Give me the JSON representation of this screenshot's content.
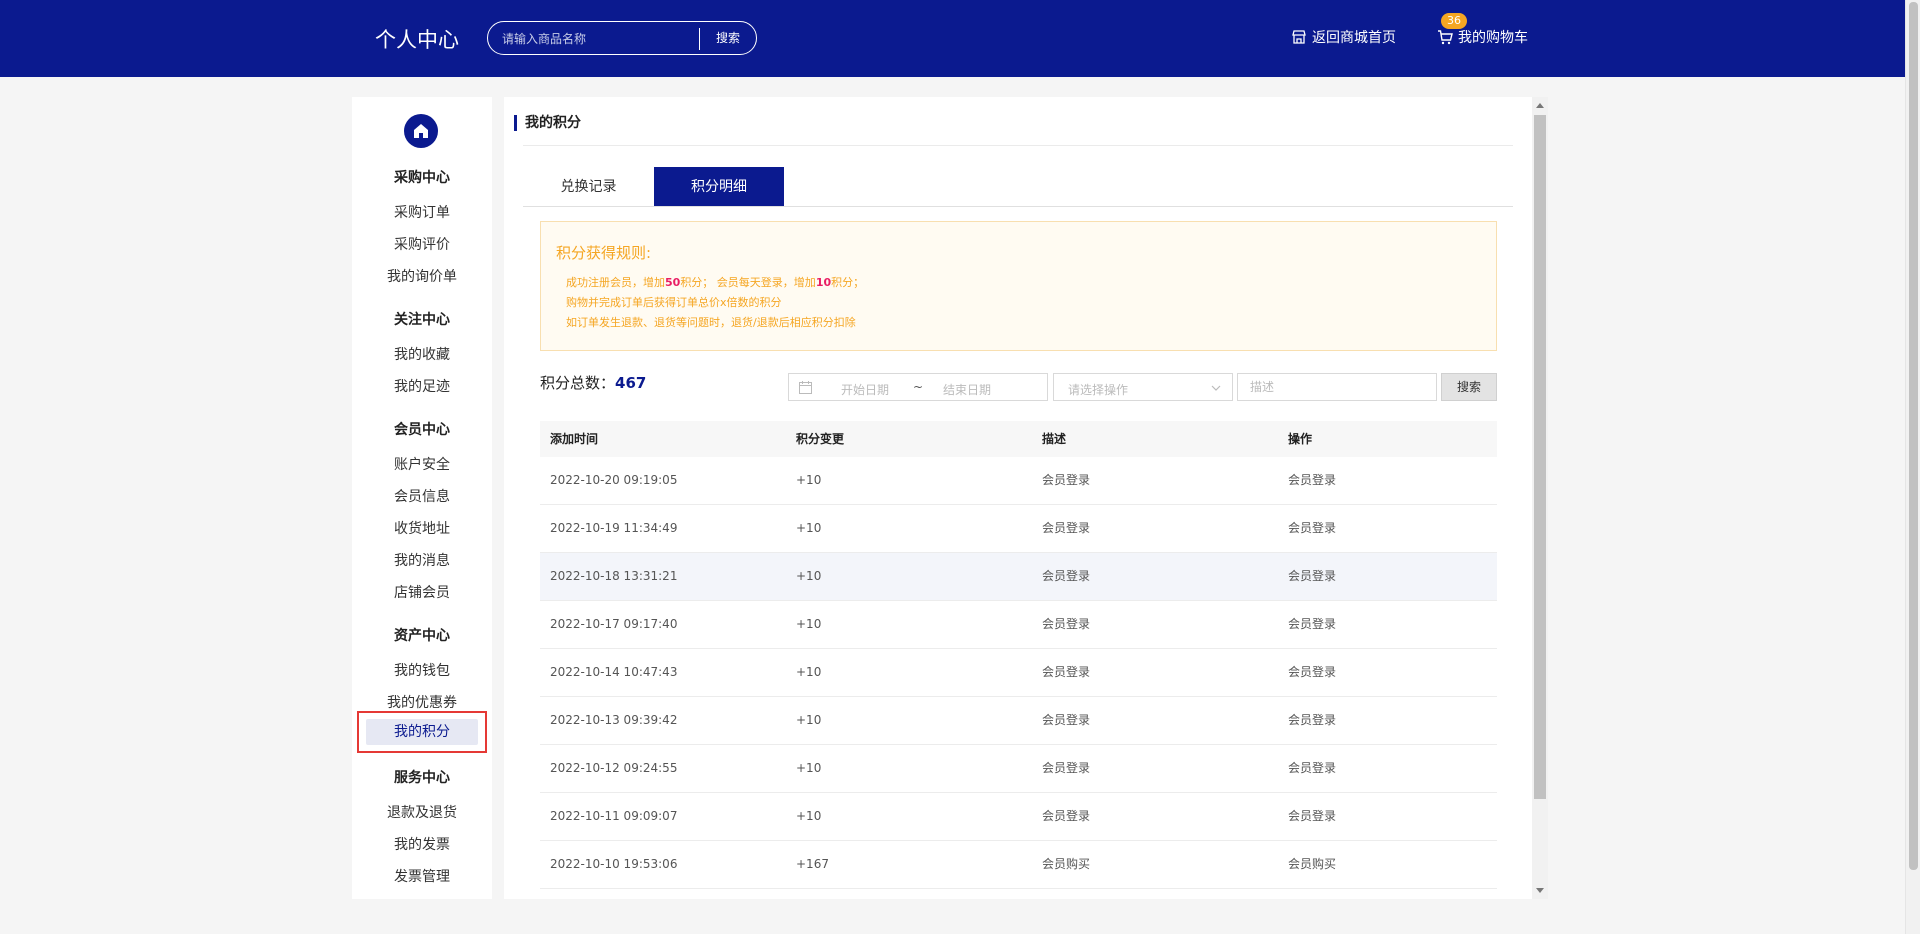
{
  "header": {
    "brand": "个人中心",
    "search_placeholder": "请输入商品名称",
    "search_button": "搜索",
    "home_link": "返回商城首页",
    "cart_link": "我的购物车",
    "cart_count": "36"
  },
  "sidebar": {
    "groups": [
      {
        "title": "采购中心",
        "items": [
          "采购订单",
          "采购评价",
          "我的询价单"
        ]
      },
      {
        "title": "关注中心",
        "items": [
          "我的收藏",
          "我的足迹"
        ]
      },
      {
        "title": "会员中心",
        "items": [
          "账户安全",
          "会员信息",
          "收货地址",
          "我的消息",
          "店铺会员"
        ]
      },
      {
        "title": "资产中心",
        "items": [
          "我的钱包",
          "我的优惠券",
          "我的积分"
        ]
      },
      {
        "title": "服务中心",
        "items": [
          "退款及退货",
          "我的发票",
          "发票管理"
        ]
      }
    ],
    "active_item": "我的积分"
  },
  "main": {
    "title": "我的积分",
    "tabs": [
      "兑换记录",
      "积分明细"
    ],
    "active_tab": "积分明细",
    "rules": {
      "title": "积分获得规则:",
      "line1_a": "成功注册会员，增加",
      "line1_b": "50",
      "line1_c": "积分；  会员每天登录，增加",
      "line1_d": "10",
      "line1_e": "积分；",
      "line2": "购物并完成订单后获得订单总价x倍数的积分",
      "line3": "如订单发生退款、退货等问题时，退货/退款后相应积分扣除"
    },
    "total_label": "积分总数：",
    "total_value": "467",
    "filters": {
      "start_date": "开始日期",
      "separator": "~",
      "end_date": "结束日期",
      "operation_placeholder": "请选择操作",
      "desc_placeholder": "描述",
      "search_button": "搜索"
    },
    "table": {
      "headers": [
        "添加时间",
        "积分变更",
        "描述",
        "操作"
      ],
      "rows": [
        [
          "2022-10-20 09:19:05",
          "+10",
          "会员登录",
          "会员登录"
        ],
        [
          "2022-10-19 11:34:49",
          "+10",
          "会员登录",
          "会员登录"
        ],
        [
          "2022-10-18 13:31:21",
          "+10",
          "会员登录",
          "会员登录"
        ],
        [
          "2022-10-17 09:17:40",
          "+10",
          "会员登录",
          "会员登录"
        ],
        [
          "2022-10-14 10:47:43",
          "+10",
          "会员登录",
          "会员登录"
        ],
        [
          "2022-10-13 09:39:42",
          "+10",
          "会员登录",
          "会员登录"
        ],
        [
          "2022-10-12 09:24:55",
          "+10",
          "会员登录",
          "会员登录"
        ],
        [
          "2022-10-11 09:09:07",
          "+10",
          "会员登录",
          "会员登录"
        ],
        [
          "2022-10-10 19:53:06",
          "+167",
          "会员购买",
          "会员购买"
        ]
      ]
    }
  },
  "colors": {
    "brand_blue": "#0b1a8f",
    "rule_orange": "#f5a623",
    "rule_highlight": "#e91e63",
    "active_outline": "#e53935"
  }
}
